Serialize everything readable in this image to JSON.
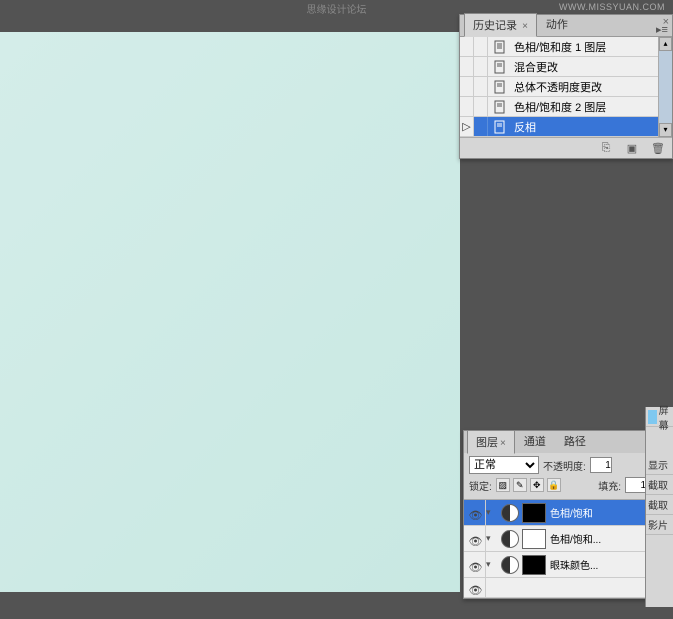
{
  "app": {
    "title": "思缘设计论坛",
    "watermark": "WWW.MISSYUAN.COM"
  },
  "history_panel": {
    "tabs": [
      {
        "label": "历史记录",
        "active": true
      },
      {
        "label": "动作",
        "active": false
      }
    ],
    "items": [
      {
        "label": "色相/饱和度 1 图层",
        "selected": false
      },
      {
        "label": "混合更改",
        "selected": false
      },
      {
        "label": "总体不透明度更改",
        "selected": false
      },
      {
        "label": "色相/饱和度 2 图层",
        "selected": false
      },
      {
        "label": "反相",
        "selected": true
      }
    ]
  },
  "layers_panel": {
    "tabs": [
      {
        "label": "图层",
        "active": true
      },
      {
        "label": "通道",
        "active": false
      },
      {
        "label": "路径",
        "active": false
      }
    ],
    "blend_mode": "正常",
    "opacity_label": "不透明度:",
    "opacity_value": "1",
    "lock_label": "锁定:",
    "fill_label": "填充:",
    "layers": [
      {
        "name": "色相/饱和",
        "selected": true,
        "mask": "#000"
      },
      {
        "name": "色相/饱和...",
        "selected": false,
        "mask": "#fff"
      },
      {
        "name": "眼珠颜色...",
        "selected": false,
        "mask": "#000"
      }
    ]
  },
  "right_panel": {
    "items": [
      "屏幕",
      "显示",
      "截取",
      "截取",
      "影片"
    ]
  }
}
